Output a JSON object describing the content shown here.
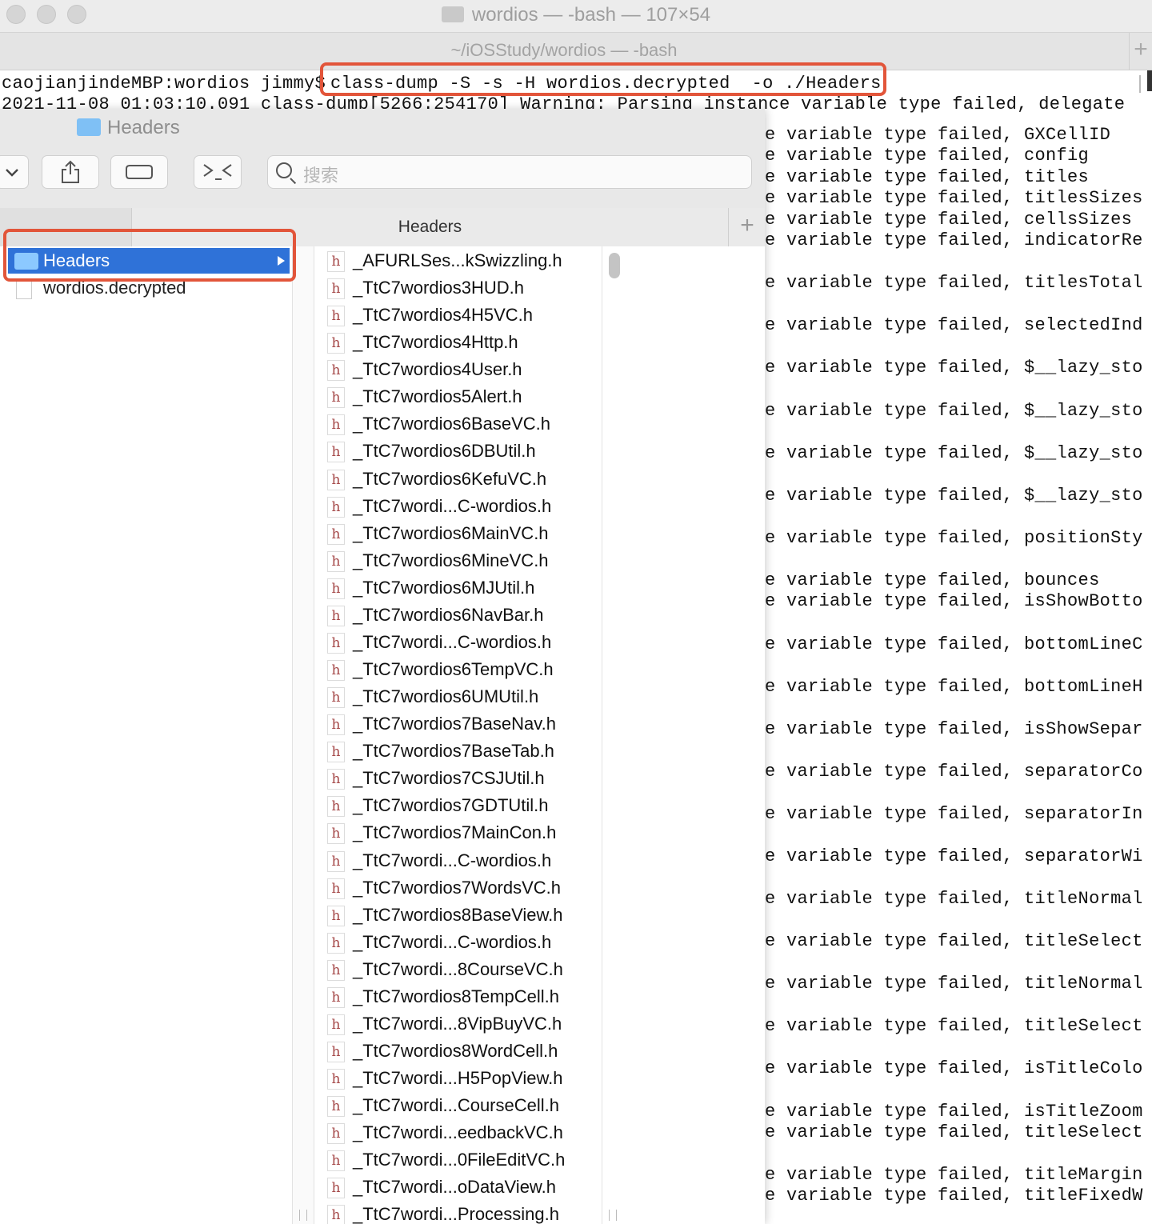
{
  "terminal": {
    "window_title": "wordios — -bash — 107×54",
    "tab_title": "~/iOSStudy/wordios — -bash",
    "new_tab_label": "+",
    "prompt": "caojianjindeMBP:wordios jimmy$ ",
    "command": "class-dump -S -s -H wordios.decrypted  -o ./Headers",
    "warning_line": "2021-11-08 01:03:10.091 class-dump[5266:254170] Warning: Parsing instance variable type failed, delegate",
    "right_lines": [
      "e variable type failed, GXCellID",
      "e variable type failed, config",
      "e variable type failed, titles",
      "e variable type failed, titlesSizes",
      "e variable type failed, cellsSizes",
      "e variable type failed, indicatorRe",
      "e variable type failed, titlesTotal",
      "e variable type failed, selectedInd",
      "e variable type failed, $__lazy_sto",
      "e variable type failed, $__lazy_sto",
      "e variable type failed, $__lazy_sto",
      "e variable type failed, $__lazy_sto",
      "e variable type failed, positionSty",
      "e variable type failed, bounces",
      "e variable type failed, isShowBotto",
      "e variable type failed, bottomLineC",
      "e variable type failed, bottomLineH",
      "e variable type failed, isShowSepar",
      "e variable type failed, separatorCo",
      "e variable type failed, separatorIn",
      "e variable type failed, separatorWi",
      "e variable type failed, titleNormal",
      "e variable type failed, titleSelect",
      "e variable type failed, titleNormal",
      "e variable type failed, titleSelect",
      "e variable type failed, isTitleColo",
      "e variable type failed, isTitleZoom",
      "e variable type failed, titleSelect",
      "e variable type failed, titleMargin",
      "e variable type failed, titleFixedW"
    ]
  },
  "finder": {
    "window_title": "Headers",
    "search_placeholder": "搜索",
    "column_header": "Headers",
    "add_label": "+",
    "sidebar_items": [
      "Headers",
      "wordios.decrypted"
    ],
    "file_icon_letter": "h",
    "files": [
      "_AFURLSes...kSwizzling.h",
      "_TtC7wordios3HUD.h",
      "_TtC7wordios4H5VC.h",
      "_TtC7wordios4Http.h",
      "_TtC7wordios4User.h",
      "_TtC7wordios5Alert.h",
      "_TtC7wordios6BaseVC.h",
      "_TtC7wordios6DBUtil.h",
      "_TtC7wordios6KefuVC.h",
      "_TtC7wordi...C-wordios.h",
      "_TtC7wordios6MainVC.h",
      "_TtC7wordios6MineVC.h",
      "_TtC7wordios6MJUtil.h",
      "_TtC7wordios6NavBar.h",
      "_TtC7wordi...C-wordios.h",
      "_TtC7wordios6TempVC.h",
      "_TtC7wordios6UMUtil.h",
      "_TtC7wordios7BaseNav.h",
      "_TtC7wordios7BaseTab.h",
      "_TtC7wordios7CSJUtil.h",
      "_TtC7wordios7GDTUtil.h",
      "_TtC7wordios7MainCon.h",
      "_TtC7wordi...C-wordios.h",
      "_TtC7wordios7WordsVC.h",
      "_TtC7wordios8BaseView.h",
      "_TtC7wordi...C-wordios.h",
      "_TtC7wordi...8CourseVC.h",
      "_TtC7wordios8TempCell.h",
      "_TtC7wordi...8VipBuyVC.h",
      "_TtC7wordios8WordCell.h",
      "_TtC7wordi...H5PopView.h",
      "_TtC7wordi...CourseCell.h",
      "_TtC7wordi...eedbackVC.h",
      "_TtC7wordi...0FileEditVC.h",
      "_TtC7wordi...oDataView.h",
      "_TtC7wordi...Processing.h"
    ]
  },
  "colors": {
    "highlight": "#e2553a",
    "selection": "#2f72d8",
    "header_icon": "#a34545"
  }
}
